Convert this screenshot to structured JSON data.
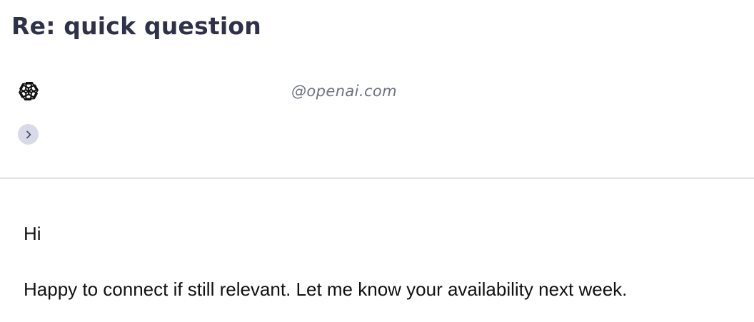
{
  "email": {
    "subject": "Re: quick question",
    "sender": {
      "logo_icon": "openai-logo-icon",
      "email_domain": "@openai.com"
    },
    "expand_icon": "chevron-right-icon",
    "body": {
      "greeting": "Hi",
      "message": "Happy to connect if still relevant. Let me know your availability next week."
    }
  },
  "colors": {
    "subject_text": "#2e3147",
    "email_text": "#6e7183",
    "expand_button_bg": "#d9dae8",
    "divider": "#e4e4e8",
    "body_text": "#111111"
  }
}
